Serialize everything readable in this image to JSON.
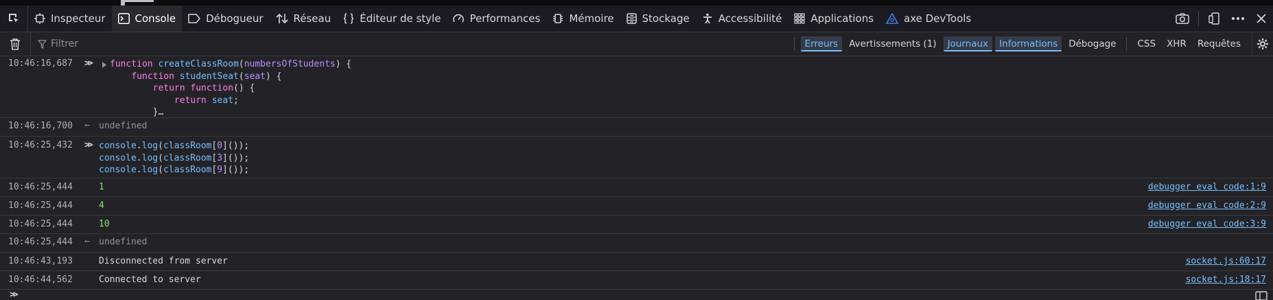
{
  "toolbar": {
    "tabs": [
      {
        "label": "Inspecteur",
        "icon": "inspector-icon"
      },
      {
        "label": "Console",
        "icon": "console-icon",
        "active": true
      },
      {
        "label": "Débogueur",
        "icon": "debugger-icon"
      },
      {
        "label": "Réseau",
        "icon": "network-icon"
      },
      {
        "label": "Éditeur de style",
        "icon": "style-editor-icon"
      },
      {
        "label": "Performances",
        "icon": "performance-icon"
      },
      {
        "label": "Mémoire",
        "icon": "memory-icon"
      },
      {
        "label": "Stockage",
        "icon": "storage-icon"
      },
      {
        "label": "Accessibilité",
        "icon": "accessibility-icon"
      },
      {
        "label": "Applications",
        "icon": "applications-icon"
      },
      {
        "label": "axe DevTools",
        "icon": "axe-icon"
      }
    ]
  },
  "filterbar": {
    "placeholder": "Filtrer",
    "levels": [
      {
        "label": "Erreurs",
        "on": true
      },
      {
        "label": "Avertissements (1)",
        "on": false
      },
      {
        "label": "Journaux",
        "on": true
      },
      {
        "label": "Informations",
        "on": true
      },
      {
        "label": "Débogage",
        "on": false
      }
    ],
    "extras": [
      "CSS",
      "XHR",
      "Requêtes"
    ]
  },
  "console": {
    "rows": [
      {
        "ts": "10:46:16,687",
        "type": "input-collapsed",
        "lines": [
          "function createClassRoom(numbersOfStudents) {",
          "    function studentSeat(seat) {",
          "        return function() {",
          "            return seat;",
          "        }…"
        ]
      },
      {
        "ts": "10:46:16,700",
        "type": "result",
        "text": "undefined"
      },
      {
        "ts": "10:46:25,432",
        "type": "input",
        "lines": [
          "console.log(classRoom[0]());",
          "console.log(classRoom[3]());",
          "console.log(classRoom[9]());"
        ]
      },
      {
        "ts": "10:46:25,444",
        "type": "log",
        "text": "1",
        "loc": "debugger eval code:1:9"
      },
      {
        "ts": "10:46:25,444",
        "type": "log",
        "text": "4",
        "loc": "debugger eval code:2:9"
      },
      {
        "ts": "10:46:25,444",
        "type": "log",
        "text": "10",
        "loc": "debugger eval code:3:9"
      },
      {
        "ts": "10:46:25,444",
        "type": "result",
        "text": "undefined"
      },
      {
        "ts": "10:46:43,193",
        "type": "log-text",
        "text": "Disconnected from server",
        "loc": "socket.js:60:17"
      },
      {
        "ts": "10:46:44,562",
        "type": "log-text",
        "text": "Connected to server",
        "loc": "socket.js:18:17"
      }
    ]
  },
  "colors": {
    "accent": "#75bfff",
    "keyword": "#ff7de9",
    "number": "#86de74",
    "identifier": "#b98eff"
  }
}
